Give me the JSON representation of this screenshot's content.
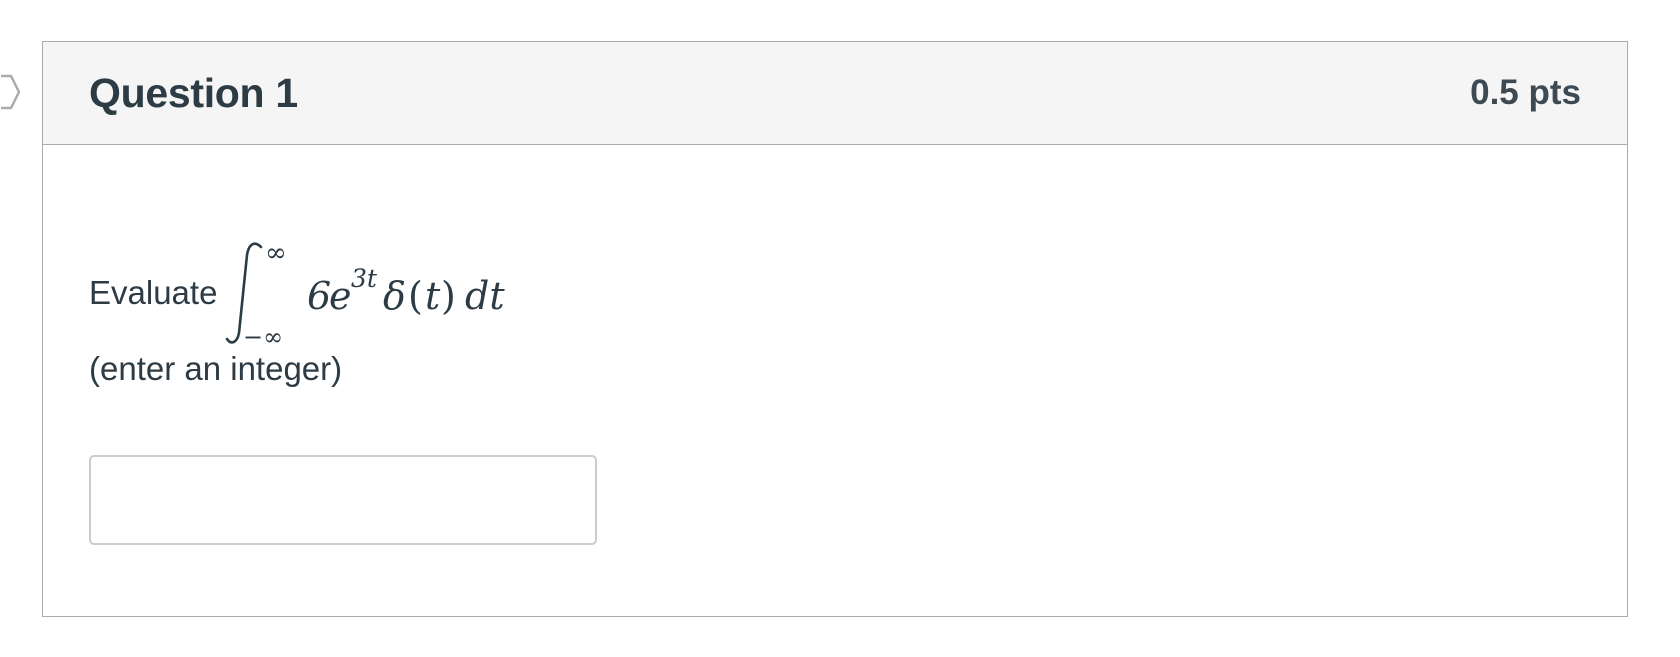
{
  "question": {
    "title": "Question 1",
    "points": "0.5 pts",
    "prompt": "Evaluate",
    "formula": {
      "integral_upper": "∞",
      "integral_lower": "−∞",
      "coefficient": "6",
      "base": "e",
      "exponent": "3t",
      "delta": "δ",
      "open_paren": "(",
      "variable": "t",
      "close_paren": ")",
      "differential": "dt"
    },
    "hint": "(enter an integer)",
    "answer": {
      "value": "",
      "placeholder": ""
    }
  },
  "colors": {
    "header_bg": "#f5f5f5",
    "border": "#a8acb0",
    "text": "#2d3b45",
    "input_border": "#c7cdd1"
  },
  "icons": {
    "flag": "flag-question-icon"
  }
}
